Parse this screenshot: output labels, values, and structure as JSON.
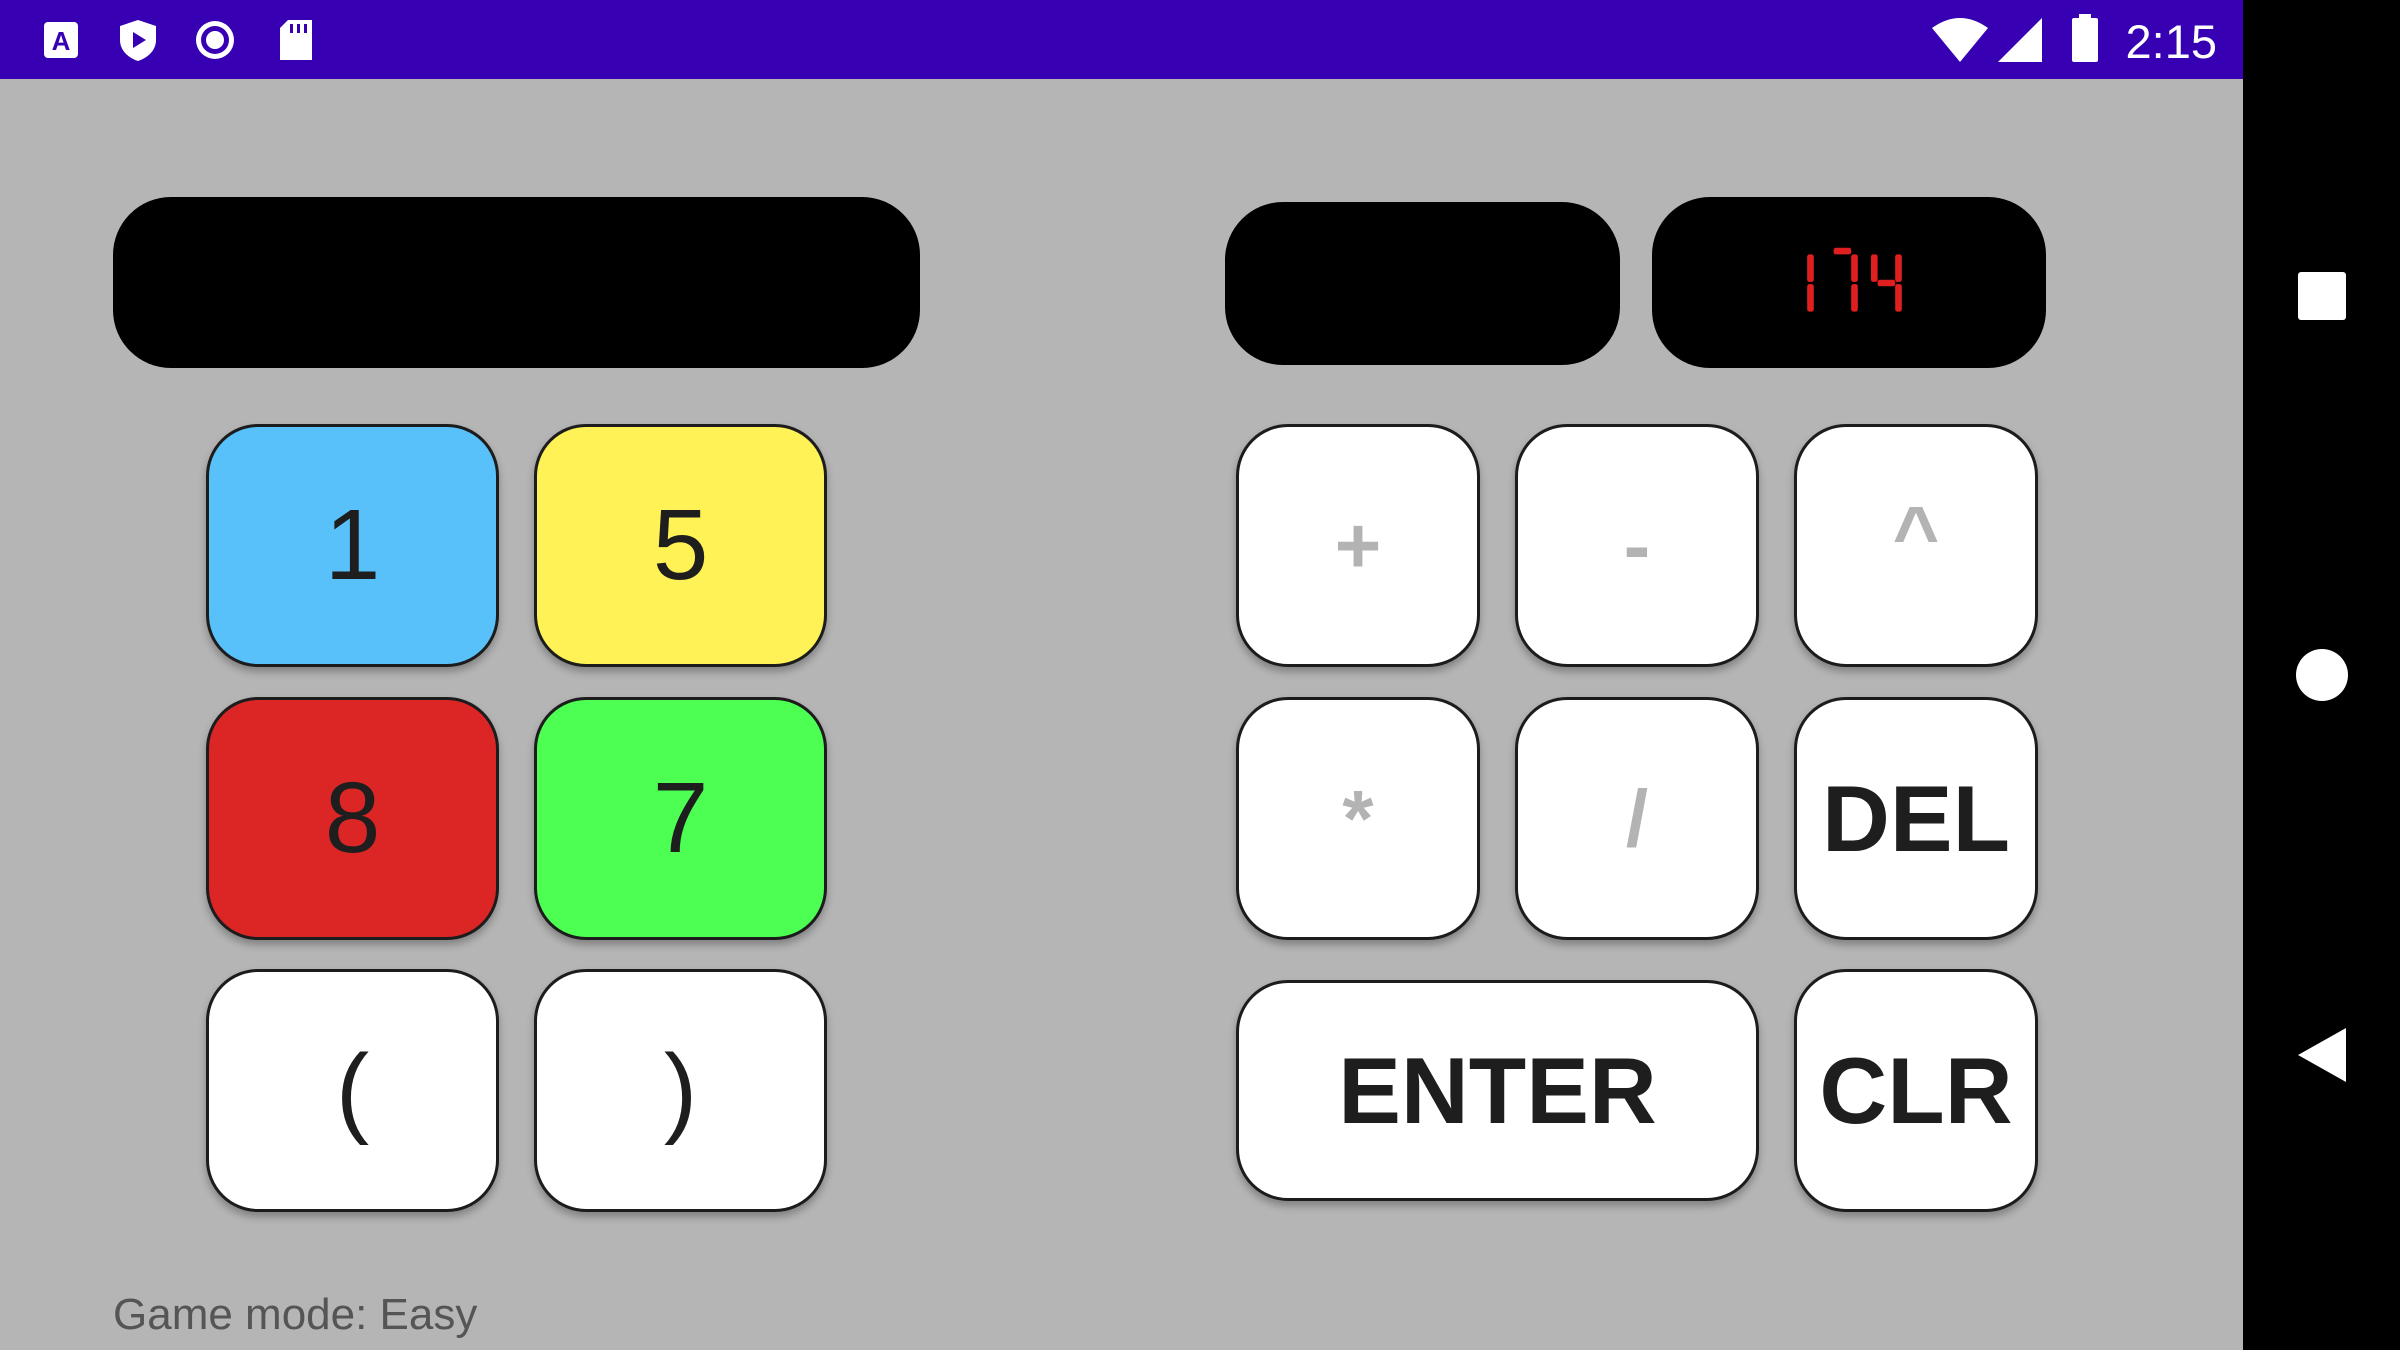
{
  "status_bar": {
    "time": "2:15",
    "icons": [
      "a-box-icon",
      "shield-icon",
      "radio-circle-icon",
      "sd-card-icon",
      "wifi-icon",
      "cell-signal-icon",
      "battery-icon"
    ]
  },
  "displays": {
    "expression": "",
    "result": "",
    "target": "174",
    "target_color": "#e02020"
  },
  "number_keys": [
    {
      "label": "1",
      "color": "#58c1fa"
    },
    {
      "label": "5",
      "color": "#fff256"
    },
    {
      "label": "8",
      "color": "#dc2626"
    },
    {
      "label": "7",
      "color": "#4cff52"
    }
  ],
  "paren_keys": {
    "open": "(",
    "close": ")"
  },
  "operator_keys": {
    "plus": "+",
    "minus": "-",
    "power": "^",
    "multiply": "*",
    "divide": "/"
  },
  "action_keys": {
    "delete": "DEL",
    "enter": "ENTER",
    "clear": "CLR"
  },
  "game_mode": "Game mode: Easy",
  "nav_bar": {
    "icons": [
      "recents-icon",
      "home-icon",
      "back-icon"
    ]
  }
}
